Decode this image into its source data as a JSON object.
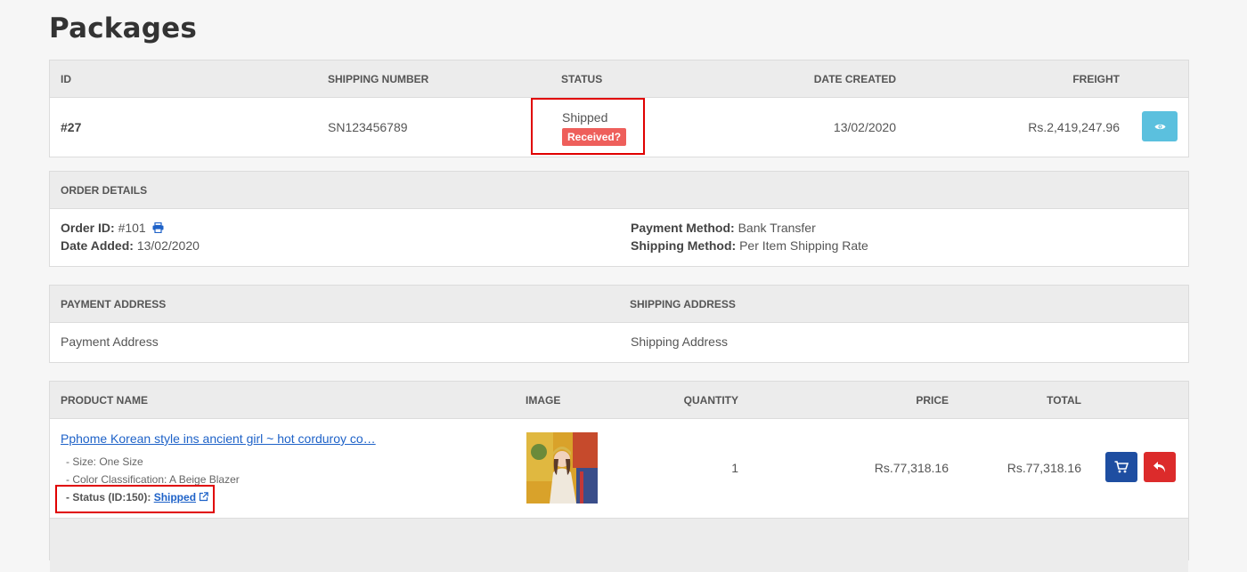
{
  "page": {
    "title": "Packages"
  },
  "packages": {
    "headers": {
      "id": "ID",
      "shipping_number": "SHIPPING NUMBER",
      "status": "STATUS",
      "date_created": "DATE CREATED",
      "freight": "FREIGHT"
    },
    "row": {
      "id": "#27",
      "shipping_number": "SN123456789",
      "status": "Shipped",
      "received_badge": "Received?",
      "date_created": "13/02/2020",
      "freight": "Rs.2,419,247.96"
    }
  },
  "order_details": {
    "header": "ORDER DETAILS",
    "order_id_label": "Order ID:",
    "order_id_value": "#101",
    "date_added_label": "Date Added:",
    "date_added_value": "13/02/2020",
    "payment_method_label": "Payment Method:",
    "payment_method_value": "Bank Transfer",
    "shipping_method_label": "Shipping Method:",
    "shipping_method_value": "Per Item Shipping Rate"
  },
  "addresses": {
    "payment_header": "PAYMENT ADDRESS",
    "shipping_header": "SHIPPING ADDRESS",
    "payment_value": "Payment Address",
    "shipping_value": "Shipping Address"
  },
  "products": {
    "headers": {
      "name": "PRODUCT NAME",
      "image": "IMAGE",
      "quantity": "QUANTITY",
      "price": "PRICE",
      "total": "TOTAL"
    },
    "row": {
      "name": "Pphome Korean style ins ancient girl ~ hot corduroy co…",
      "option_size": "- Size: One Size",
      "option_color": "- Color Classification: A Beige Blazer",
      "status_label": "- Status (ID:150):",
      "status_link": "Shipped",
      "quantity": "1",
      "price": "Rs.77,318.16",
      "total": "Rs.77,318.16"
    }
  },
  "colors": {
    "accent_info": "#5bc0de",
    "primary": "#1e4ea1",
    "danger": "#dc2b2b",
    "badge": "#ee5f5b",
    "highlight": "#e00000"
  },
  "icons": [
    "print-icon",
    "eye-icon",
    "cart-icon",
    "reply-icon",
    "external-link-icon"
  ]
}
